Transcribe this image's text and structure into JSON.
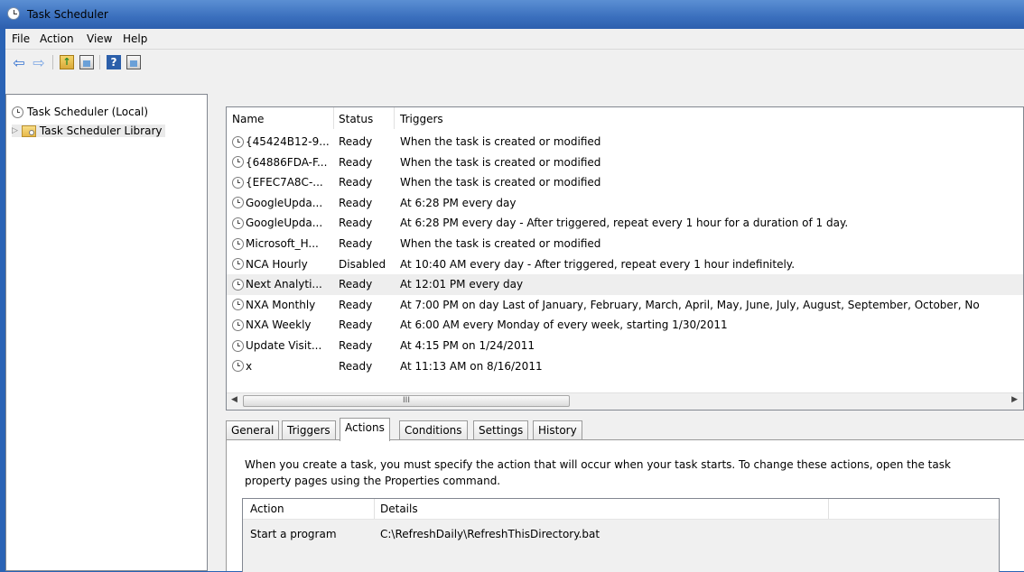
{
  "window": {
    "title": "Task Scheduler"
  },
  "menu": [
    "File",
    "Action",
    "View",
    "Help"
  ],
  "toolbar": {
    "icons": [
      "back-arrow-icon",
      "forward-arrow-icon",
      "up-folder-icon",
      "show-hide-console-tree-icon",
      "help-icon",
      "show-hide-action-pane-icon"
    ]
  },
  "tree": {
    "root": "Task Scheduler (Local)",
    "library": "Task Scheduler Library"
  },
  "task_list": {
    "columns": [
      "Name",
      "Status",
      "Triggers"
    ],
    "rows": [
      {
        "name": "{45424B12-9...",
        "status": "Ready",
        "trigger": "When the task is created or modified"
      },
      {
        "name": "{64886FDA-F...",
        "status": "Ready",
        "trigger": "When the task is created or modified"
      },
      {
        "name": "{EFEC7A8C-...",
        "status": "Ready",
        "trigger": "When the task is created or modified"
      },
      {
        "name": "GoogleUpda...",
        "status": "Ready",
        "trigger": "At 6:28 PM every day"
      },
      {
        "name": "GoogleUpda...",
        "status": "Ready",
        "trigger": "At 6:28 PM every day - After triggered, repeat every 1 hour for a duration of 1 day."
      },
      {
        "name": "Microsoft_H...",
        "status": "Ready",
        "trigger": "When the task is created or modified"
      },
      {
        "name": "NCA Hourly",
        "status": "Disabled",
        "trigger": "At 10:40 AM every day - After triggered, repeat every 1 hour indefinitely."
      },
      {
        "name": "Next Analyti...",
        "status": "Ready",
        "trigger": "At 12:01 PM every day",
        "selected": true
      },
      {
        "name": "NXA Monthly",
        "status": "Ready",
        "trigger": "At 7:00 PM  on day Last of January, February, March, April, May, June, July, August, September, October, No"
      },
      {
        "name": "NXA Weekly",
        "status": "Ready",
        "trigger": "At 6:00 AM every Monday of every week, starting 1/30/2011"
      },
      {
        "name": "Update Visit...",
        "status": "Ready",
        "trigger": "At 4:15 PM on 1/24/2011"
      },
      {
        "name": "x",
        "status": "Ready",
        "trigger": "At 11:13 AM on 8/16/2011"
      }
    ],
    "scroll_thumb_label": "III"
  },
  "tabs": [
    "General",
    "Triggers",
    "Actions",
    "Conditions",
    "Settings",
    "History"
  ],
  "active_tab": "Actions",
  "actions_tab": {
    "description": "When you create a task, you must specify the action that will occur when your task starts.  To change these actions, open the task property pages using the Properties command.",
    "columns": [
      "Action",
      "Details"
    ],
    "rows": [
      {
        "action": "Start a program",
        "details": "C:\\RefreshDaily\\RefreshThisDirectory.bat"
      }
    ]
  }
}
